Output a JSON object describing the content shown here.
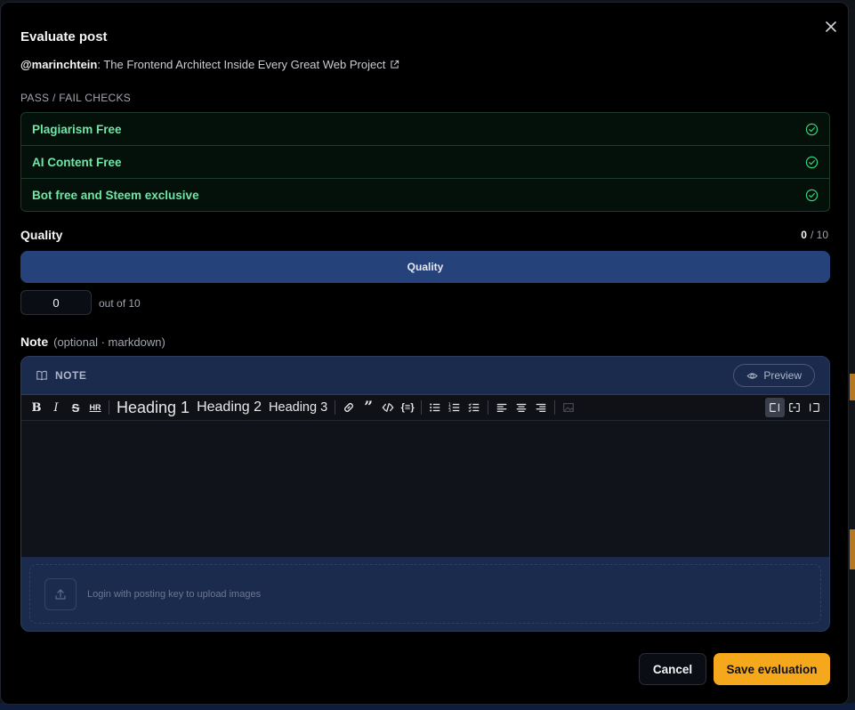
{
  "dialog": {
    "title": "Evaluate post",
    "author": "@marinchtein",
    "post_title": ": The Frontend Architect Inside Every Great Web Project"
  },
  "checks": {
    "section_label": "PASS / FAIL CHECKS",
    "items": [
      {
        "label": "Plagiarism Free",
        "status": "pass"
      },
      {
        "label": "AI Content Free",
        "status": "pass"
      },
      {
        "label": "Bot free and Steem exclusive",
        "status": "pass"
      }
    ]
  },
  "quality": {
    "label": "Quality",
    "score": "0",
    "max_text": "/ 10",
    "bar_label": "Quality",
    "input_value": "0",
    "out_of": "out of 10"
  },
  "note": {
    "label": "Note",
    "hint": "(optional · markdown)",
    "header": "NOTE",
    "preview_label": "Preview",
    "toolbar": {
      "h1": "Heading 1",
      "h2": "Heading 2",
      "h3": "Heading 3"
    },
    "upload_text": "Login with posting key to upload images"
  },
  "actions": {
    "cancel_label": "Cancel",
    "save_label": "Save evaluation"
  },
  "colors": {
    "accent": "#f5a81c",
    "pass_green": "#6ee7a7",
    "quality_bar": "#26427a"
  }
}
